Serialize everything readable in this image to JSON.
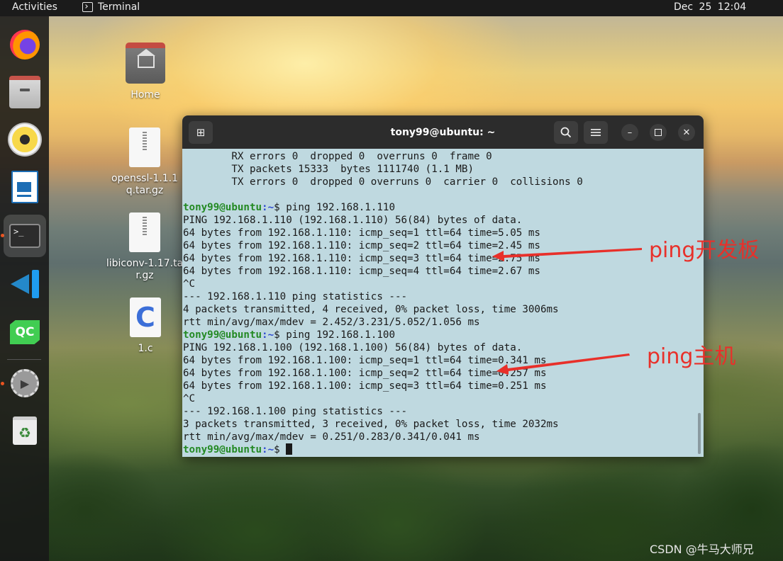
{
  "topbar": {
    "activities": "Activities",
    "app_name": "Terminal",
    "clock": "Dec 25  12:04"
  },
  "dock": {
    "items": [
      {
        "name": "firefox",
        "icon": "firefox-icon"
      },
      {
        "name": "files",
        "icon": "files-icon"
      },
      {
        "name": "rhythmbox",
        "icon": "rhythmbox-icon"
      },
      {
        "name": "writer",
        "icon": "libreoffice-writer-icon"
      },
      {
        "name": "terminal",
        "icon": "terminal-icon",
        "active": true
      },
      {
        "name": "vscode",
        "icon": "vscode-icon"
      },
      {
        "name": "qt-creator",
        "icon": "qt-creator-icon",
        "label": "QC"
      },
      {
        "name": "settings",
        "icon": "settings-icon"
      },
      {
        "name": "trash",
        "icon": "trash-icon"
      }
    ],
    "terminal_glyph": ">_"
  },
  "desktop": {
    "home": "Home",
    "openssl": "openssl-1.1.1q.tar.gz",
    "libiconv": "libiconv-1.17.tar.gz",
    "cfile": "1.c",
    "cfile_glyph": "C"
  },
  "terminal": {
    "title": "tony99@ubuntu: ~",
    "prompt_user": "tony99@ubuntu",
    "prompt_path": ":~",
    "prompt_sign": "$ ",
    "lines": [
      {
        "type": "text",
        "text": "        RX errors 0  dropped 0  overruns 0  frame 0"
      },
      {
        "type": "text",
        "text": "        TX packets 15333  bytes 1111740 (1.1 MB)"
      },
      {
        "type": "text",
        "text": "        TX errors 0  dropped 0 overruns 0  carrier 0  collisions 0"
      },
      {
        "type": "text",
        "text": ""
      },
      {
        "type": "prompt",
        "command": "ping 192.168.1.110"
      },
      {
        "type": "text",
        "text": "PING 192.168.1.110 (192.168.1.110) 56(84) bytes of data."
      },
      {
        "type": "text",
        "text": "64 bytes from 192.168.1.110: icmp_seq=1 ttl=64 time=5.05 ms"
      },
      {
        "type": "text",
        "text": "64 bytes from 192.168.1.110: icmp_seq=2 ttl=64 time=2.45 ms"
      },
      {
        "type": "text",
        "text": "64 bytes from 192.168.1.110: icmp_seq=3 ttl=64 time=2.75 ms"
      },
      {
        "type": "text",
        "text": "64 bytes from 192.168.1.110: icmp_seq=4 ttl=64 time=2.67 ms"
      },
      {
        "type": "text",
        "text": "^C"
      },
      {
        "type": "text",
        "text": "--- 192.168.1.110 ping statistics ---"
      },
      {
        "type": "text",
        "text": "4 packets transmitted, 4 received, 0% packet loss, time 3006ms"
      },
      {
        "type": "text",
        "text": "rtt min/avg/max/mdev = 2.452/3.231/5.052/1.056 ms"
      },
      {
        "type": "prompt",
        "command": "ping 192.168.1.100"
      },
      {
        "type": "text",
        "text": "PING 192.168.1.100 (192.168.1.100) 56(84) bytes of data."
      },
      {
        "type": "text",
        "text": "64 bytes from 192.168.1.100: icmp_seq=1 ttl=64 time=0.341 ms"
      },
      {
        "type": "text",
        "text": "64 bytes from 192.168.1.100: icmp_seq=2 ttl=64 time=0.257 ms"
      },
      {
        "type": "text",
        "text": "64 bytes from 192.168.1.100: icmp_seq=3 ttl=64 time=0.251 ms"
      },
      {
        "type": "text",
        "text": "^C"
      },
      {
        "type": "text",
        "text": "--- 192.168.1.100 ping statistics ---"
      },
      {
        "type": "text",
        "text": "3 packets transmitted, 3 received, 0% packet loss, time 2032ms"
      },
      {
        "type": "text",
        "text": "rtt min/avg/max/mdev = 0.251/0.283/0.341/0.041 ms"
      },
      {
        "type": "prompt",
        "command": "",
        "cursor": true
      }
    ],
    "buttons": {
      "new_tab_icon": "new-tab-icon",
      "search_icon": "search-icon",
      "menu_icon": "hamburger-menu-icon",
      "minimize_icon": "minimize-icon",
      "maximize_icon": "maximize-icon",
      "close_icon": "close-icon"
    }
  },
  "annotations": {
    "board": "ping开发板",
    "host": "ping主机",
    "color": "#e8302a"
  },
  "watermark": "CSDN @牛马大师兄",
  "colors": {
    "terminal_bg": "#bfd9e0",
    "prompt_user": "#248a24",
    "prompt_path": "#2f4bd1",
    "header_bg": "#2c2c2c"
  }
}
